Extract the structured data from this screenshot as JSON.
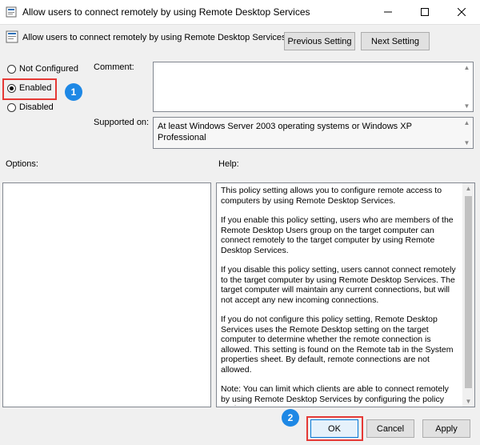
{
  "window": {
    "title": "Allow users to connect remotely by using Remote Desktop Services",
    "controls": {
      "minimize": "minimize",
      "maximize": "maximize",
      "close": "close"
    }
  },
  "header": {
    "policy_name": "Allow users to connect remotely by using Remote Desktop Services",
    "previous_label": "Previous Setting",
    "next_label": "Next Setting"
  },
  "state": {
    "options": [
      {
        "label": "Not Configured",
        "checked": false
      },
      {
        "label": "Enabled",
        "checked": true
      },
      {
        "label": "Disabled",
        "checked": false
      }
    ]
  },
  "fields": {
    "comment_label": "Comment:",
    "comment_value": "",
    "supported_label": "Supported on:",
    "supported_value": "At least Windows Server 2003 operating systems or Windows XP Professional"
  },
  "panels": {
    "options_label": "Options:",
    "help_label": "Help:",
    "help_paragraphs": [
      "This policy setting allows you to configure remote access to computers by using Remote Desktop Services.",
      "If you enable this policy setting, users who are members of the Remote Desktop Users group on the target computer can connect remotely to the target computer by using Remote Desktop Services.",
      "If you disable this policy setting, users cannot connect remotely to the target computer by using Remote Desktop Services. The target computer will maintain any current connections, but will not accept any new incoming connections.",
      "If you do not configure this policy setting, Remote Desktop Services uses the Remote Desktop setting on the target computer to determine whether the remote connection is allowed. This setting is found on the Remote tab in the System properties sheet. By default, remote connections are not allowed.",
      "Note: You can limit which clients are able to connect remotely by using Remote Desktop Services by configuring the policy setting"
    ]
  },
  "annotations": {
    "step1": "1",
    "step2": "2",
    "highlight_color": "#e53935",
    "badge_color": "#1e88e5"
  },
  "footer": {
    "ok_label": "OK",
    "cancel_label": "Cancel",
    "apply_label": "Apply"
  }
}
